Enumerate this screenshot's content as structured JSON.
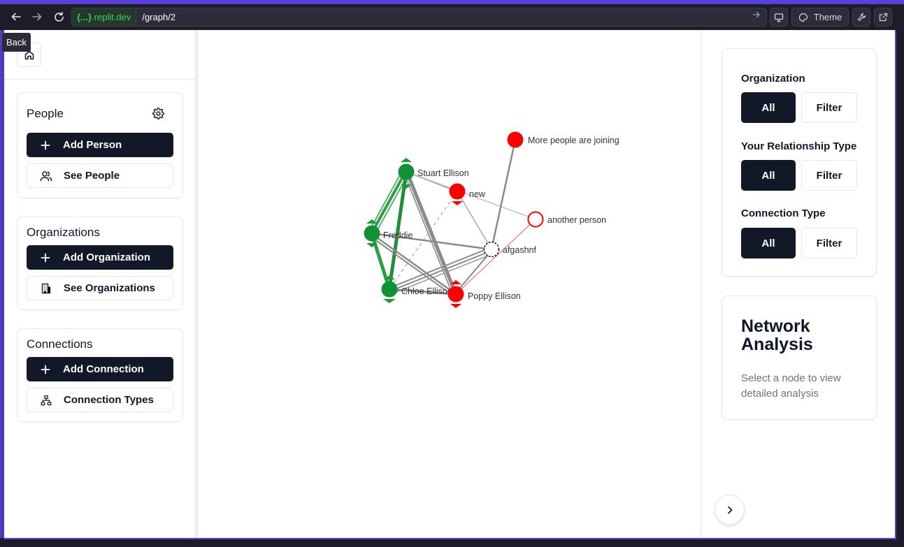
{
  "browser": {
    "url_host": "{...}.replit.dev",
    "url_host_brace": "{...}",
    "url_host_domain": ".replit.dev",
    "url_path": "/graph/2",
    "theme_label": "Theme",
    "back_tooltip": "Back"
  },
  "sidebar": {
    "people": {
      "title": "People",
      "add_label": "Add Person",
      "see_label": "See People"
    },
    "organizations": {
      "title": "Organizations",
      "add_label": "Add Organization",
      "see_label": "See Organizations"
    },
    "connections": {
      "title": "Connections",
      "add_label": "Add Connection",
      "types_label": "Connection Types"
    }
  },
  "graph": {
    "nodes": [
      {
        "id": "stuart",
        "label": "Stuart Ellison",
        "color": "#109232"
      },
      {
        "id": "freddie",
        "label": "Freddie",
        "color": "#109232"
      },
      {
        "id": "chloe",
        "label": "Chloe Ellison",
        "color": "#109232"
      },
      {
        "id": "new",
        "label": "new",
        "color": "#ff0000"
      },
      {
        "id": "poppy",
        "label": "Poppy Ellison",
        "color": "#ff0000"
      },
      {
        "id": "more",
        "label": "More people are joining",
        "color": "#ff0000"
      },
      {
        "id": "another",
        "label": "another person",
        "color": "#ff0000"
      },
      {
        "id": "afgashnf",
        "label": "afgashnf",
        "color": "#000000"
      }
    ]
  },
  "filters": {
    "organization": {
      "label": "Organization",
      "all": "All",
      "filter": "Filter"
    },
    "relationship": {
      "label": "Your Relationship Type",
      "all": "All",
      "filter": "Filter"
    },
    "connection": {
      "label": "Connection Type",
      "all": "All",
      "filter": "Filter"
    }
  },
  "analysis": {
    "title": "Network Analysis",
    "description": "Select a node to view detailed analysis"
  },
  "colors": {
    "accent": "#5b3fd9",
    "dark_button": "#111827",
    "green_node": "#109232",
    "red_node": "#ff0000"
  }
}
